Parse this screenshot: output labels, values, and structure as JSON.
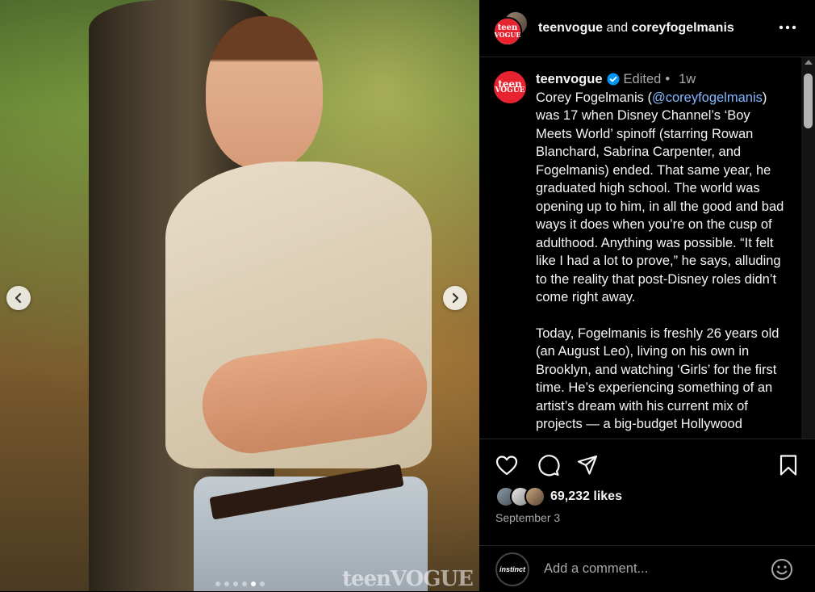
{
  "media": {
    "watermark": "teenVOGUE",
    "carousel": {
      "total": 6,
      "current": 5
    },
    "prev_icon": "chevron-left-icon",
    "next_icon": "chevron-right-icon"
  },
  "header": {
    "account1": "teenvogue",
    "and": "and",
    "account2": "coreyfogelmanis",
    "more_icon": "more-horizontal-icon"
  },
  "logo": {
    "line1": "teen",
    "line2": "VOGUE",
    "color": "#e8222e"
  },
  "caption": {
    "username": "teenvogue",
    "verified_color": "#0095f6",
    "edited": "Edited",
    "separator": "•",
    "time": "1w",
    "p1_before": "Corey Fogelmanis (",
    "mention": "@coreyfogelmanis",
    "p1_after": ") was 17 when Disney Channel’s ‘Boy Meets World’ spinoff (starring Rowan Blanchard, Sabrina Carpenter, and Fogelmanis) ended. That same year, he graduated high school. The world was opening up to him, in all the good and bad ways it does when you’re on the cusp of adulthood. Anything was possible. “It felt like I had a lot to prove,” he says, alluding to the reality that post-Disney roles didn’t come right away.",
    "p2": "Today, Fogelmanis is freshly 26 years old (an August Leo), living on his own in Brooklyn, and watching ‘Girls’ for the first time. He’s experiencing something of an artist’s dream with his current mix of projects — a big-budget Hollywood"
  },
  "actions": {
    "like_icon": "heart-icon",
    "comment_icon": "comment-icon",
    "share_icon": "send-icon",
    "save_icon": "bookmark-icon"
  },
  "likes": {
    "count_text": "69,232 likes"
  },
  "date": "September 3",
  "comment": {
    "avatar_text": "instinct",
    "placeholder": "Add a comment...",
    "emoji_icon": "smiley-icon"
  }
}
